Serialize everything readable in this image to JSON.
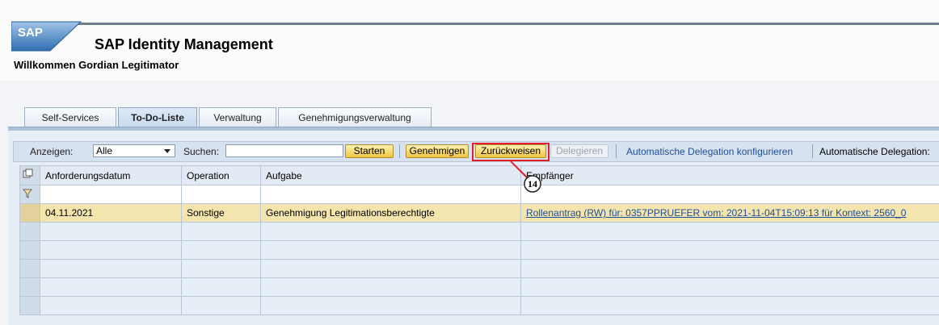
{
  "header": {
    "logo_text": "SAP",
    "app_title": "SAP Identity Management",
    "welcome": "Willkommen Gordian Legitimator"
  },
  "tabs": [
    {
      "label": "Self-Services",
      "active": false
    },
    {
      "label": "To-Do-Liste",
      "active": true
    },
    {
      "label": "Verwaltung",
      "active": false
    },
    {
      "label": "Genehmigungsverwaltung",
      "active": false
    }
  ],
  "toolbar": {
    "show_label": "Anzeigen:",
    "show_value": "Alle",
    "search_label": "Suchen:",
    "search_value": "",
    "start_button": "Starten",
    "approve_button": "Genehmigen",
    "reject_button": "Zurückweisen",
    "delegate_button": "Delegieren",
    "auto_delegation_config_link": "Automatische Delegation konfigurieren",
    "auto_delegation_text": "Automatische Delegation:"
  },
  "table": {
    "columns": [
      "Anforderungsdatum",
      "Operation",
      "Aufgabe",
      "Empfänger"
    ],
    "rows": [
      {
        "date": "04.11.2021",
        "operation": "Sonstige",
        "task": "Genehmigung Legitimationsberechtigte",
        "recipient": "Rollenantrag (RW) für: 0357PPRUEFER vom: 2021-11-04T15:09:13 für Kontext: 2560_0"
      }
    ]
  },
  "annotation": {
    "callout_number": "14"
  },
  "colors": {
    "highlight": "#e0202a",
    "button": "#f1c542",
    "selected_row": "#f4e4ad"
  }
}
